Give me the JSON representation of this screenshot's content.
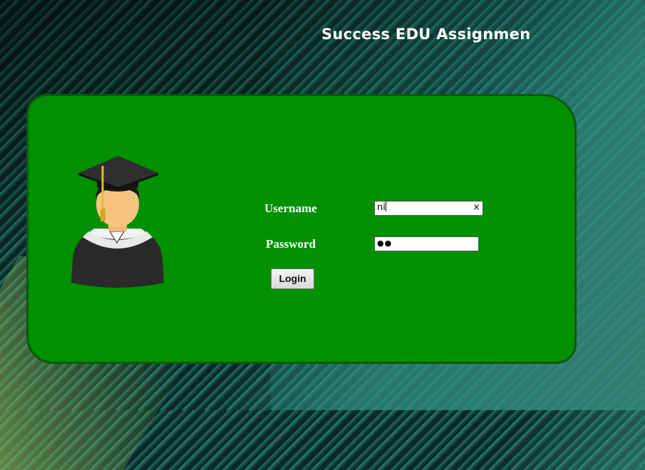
{
  "page": {
    "title": "Success EDU Assignmen"
  },
  "login_form": {
    "username_label": "Username",
    "username_value": "ni",
    "password_label": "Password",
    "password_masked": "●●",
    "clear_glyph": "×",
    "login_button_label": "Login"
  },
  "icons": {
    "avatar": "graduate-avatar-icon",
    "clear": "clear-input-icon"
  },
  "colors": {
    "panel": "#009000",
    "panel_border": "#0b5a10",
    "title_text": "#ffffff"
  }
}
